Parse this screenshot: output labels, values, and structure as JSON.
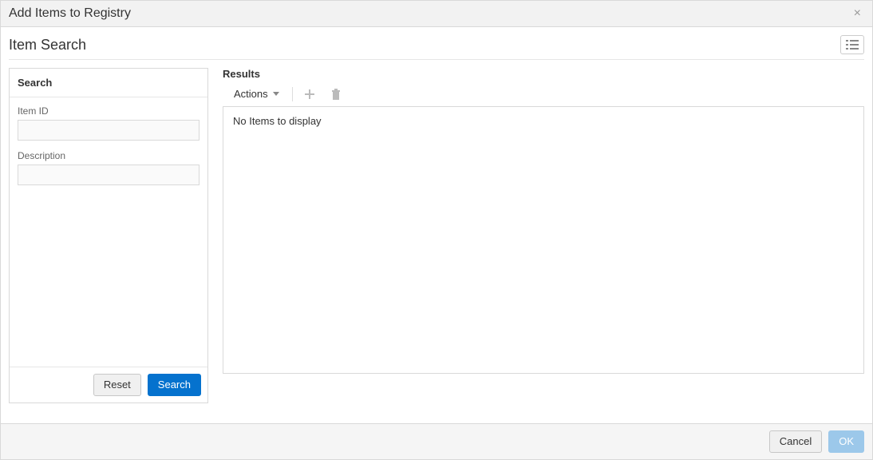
{
  "dialog": {
    "title": "Add Items to Registry",
    "close_label": "×"
  },
  "section": {
    "title": "Item Search"
  },
  "search": {
    "panel_title": "Search",
    "item_id_label": "Item ID",
    "item_id_value": "",
    "description_label": "Description",
    "description_value": "",
    "reset_label": "Reset",
    "search_label": "Search"
  },
  "results": {
    "title": "Results",
    "actions_label": "Actions",
    "empty_message": "No Items to display"
  },
  "footer": {
    "cancel_label": "Cancel",
    "ok_label": "OK"
  }
}
